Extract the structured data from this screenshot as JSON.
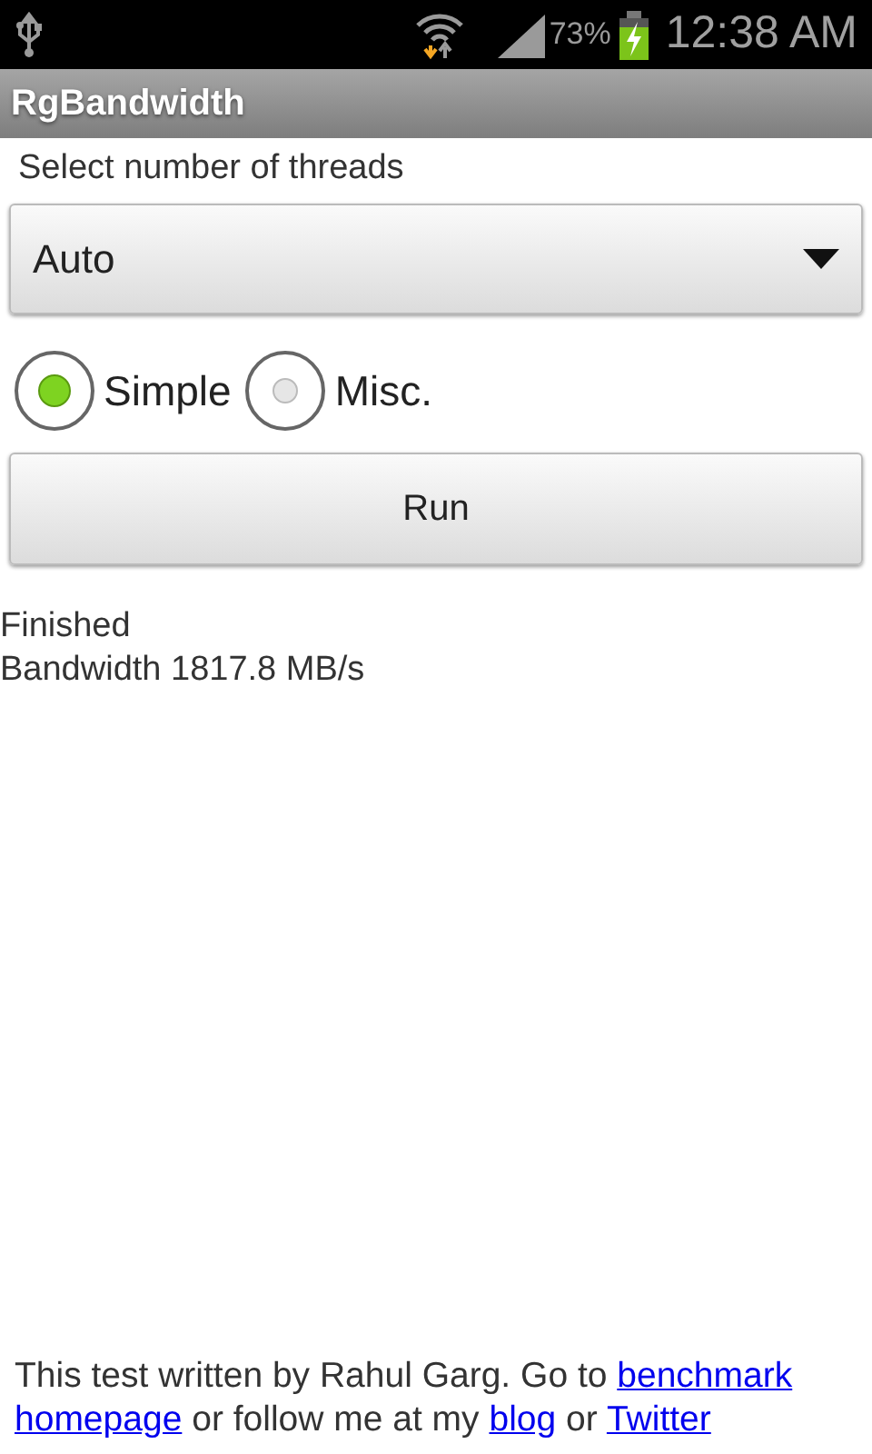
{
  "status_bar": {
    "battery_percent": "73%",
    "time": "12:38 AM"
  },
  "action_bar": {
    "title": "RgBandwidth"
  },
  "threads": {
    "label": "Select number of threads",
    "value": "Auto"
  },
  "modes": [
    {
      "label": "Simple",
      "selected": true
    },
    {
      "label": "Misc.",
      "selected": false
    }
  ],
  "run_button": {
    "label": "Run"
  },
  "output": [
    "Finished",
    "Bandwidth 1817.8 MB/s"
  ],
  "footer": [
    {
      "kind": "text",
      "text": "This test written by Rahul Garg. Go to"
    },
    {
      "kind": "link",
      "text": "benchmark"
    },
    {
      "kind": "link",
      "text": "homepage"
    },
    {
      "kind": "text",
      "text": "or follow me at my"
    },
    {
      "kind": "link",
      "text": "blog"
    },
    {
      "kind": "text",
      "text": "or"
    },
    {
      "kind": "link",
      "text": "Twitter"
    }
  ]
}
